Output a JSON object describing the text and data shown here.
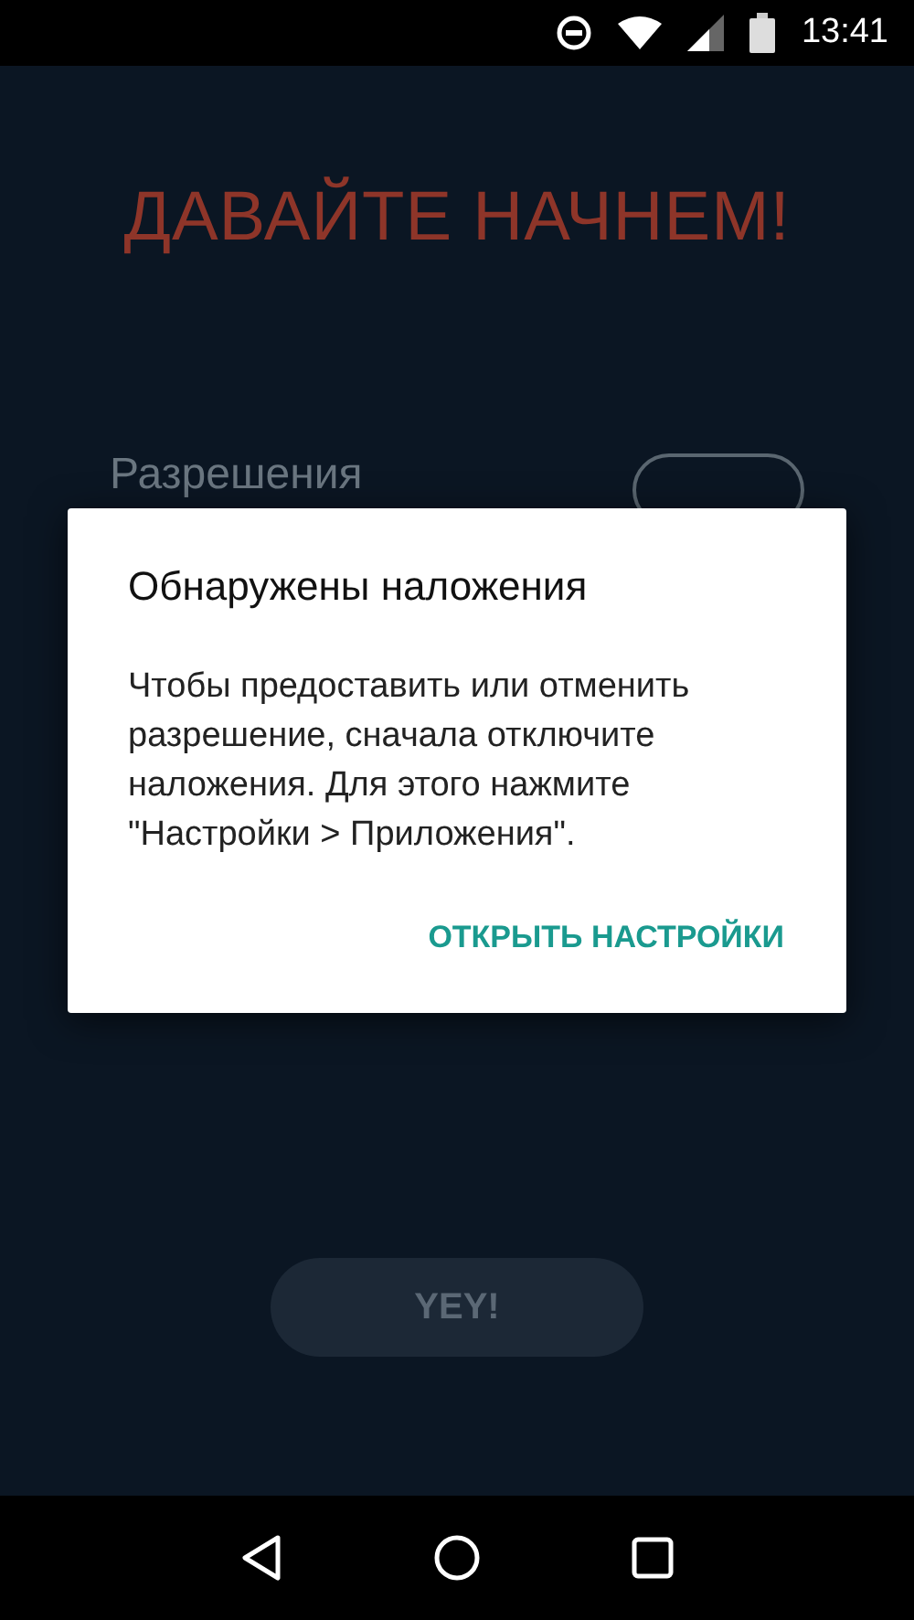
{
  "status_bar": {
    "time": "13:41"
  },
  "screen": {
    "title": "ДАВАЙТЕ НАЧНЕМ!",
    "permission_label": "Разрешения",
    "primary_button": {
      "label": "YEY!",
      "disabled": true
    }
  },
  "dialog": {
    "title": "Обнаружены наложения",
    "message": "Чтобы предоставить или отменить разрешение, сначала отключите наложения. Для этого нажмите \"Настройки > Приложения\".",
    "action": "ОТКРЫТЬ НАСТРОЙКИ"
  }
}
